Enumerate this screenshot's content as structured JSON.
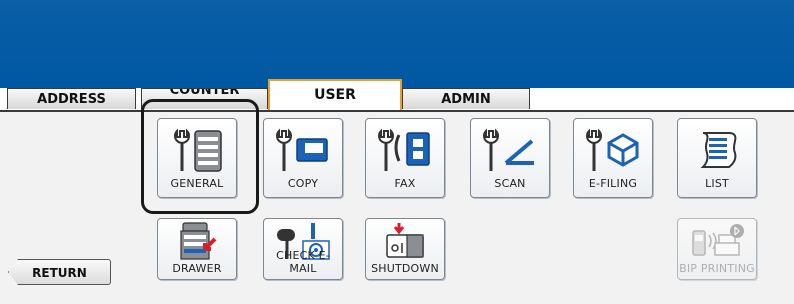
{
  "tabs": {
    "address": "ADDRESS",
    "counter": "COUNTER",
    "user": "USER",
    "admin": "ADMIN"
  },
  "buttons": {
    "general": "GENERAL",
    "copy": "COPY",
    "fax": "FAX",
    "scan": "SCAN",
    "efiling": "E-FILING",
    "list": "LIST",
    "drawer": "DRAWER",
    "check_email": "CHECK E-MAIL",
    "shutdown": "SHUTDOWN",
    "bip_printing": "BIP PRINTING"
  },
  "return_label": "RETURN",
  "colors": {
    "header_blue": "#0058a2",
    "active_tab_border": "#e9a02c",
    "icon_blue": "#1c63b8",
    "alert_red": "#d4202a"
  }
}
